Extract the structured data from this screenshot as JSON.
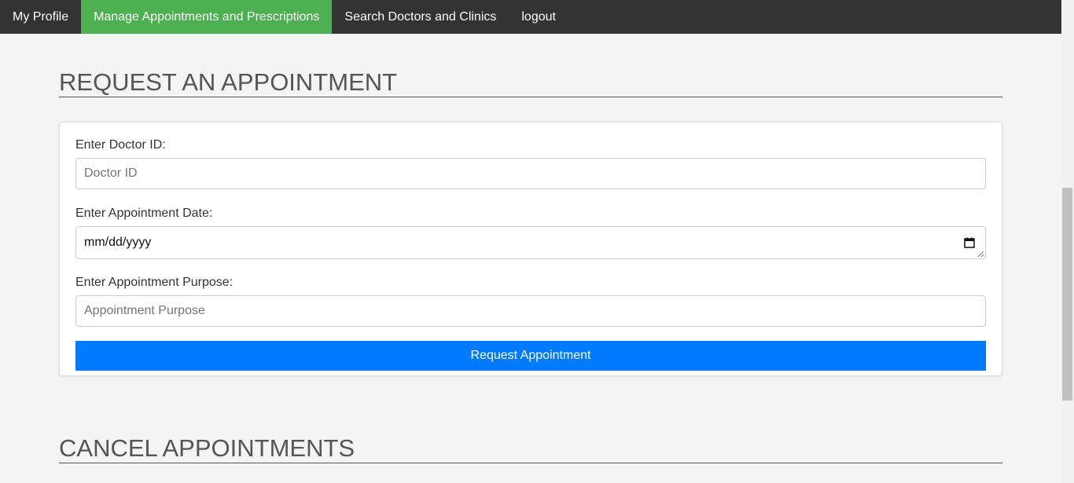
{
  "nav": {
    "items": [
      {
        "label": "My Profile",
        "active": false
      },
      {
        "label": "Manage Appointments and Prescriptions",
        "active": true
      },
      {
        "label": "Search Doctors and Clinics",
        "active": false
      },
      {
        "label": "logout",
        "active": false
      }
    ]
  },
  "request_section": {
    "title": "REQUEST AN APPOINTMENT",
    "doctor_id_label": "Enter Doctor ID:",
    "doctor_id_placeholder": "Doctor ID",
    "doctor_id_value": "",
    "date_label": "Enter Appointment Date:",
    "date_value": "mm/dd/yyyy",
    "date_icon": "calendar-icon",
    "purpose_label": "Enter Appointment Purpose:",
    "purpose_placeholder": "Appointment Purpose",
    "purpose_value": "",
    "submit_label": "Request Appointment"
  },
  "cancel_section": {
    "title": "CANCEL APPOINTMENTS"
  },
  "colors": {
    "nav_bg": "#333333",
    "nav_active": "#4caf50",
    "button_primary": "#007bff",
    "page_bg": "#f4f4f4"
  }
}
